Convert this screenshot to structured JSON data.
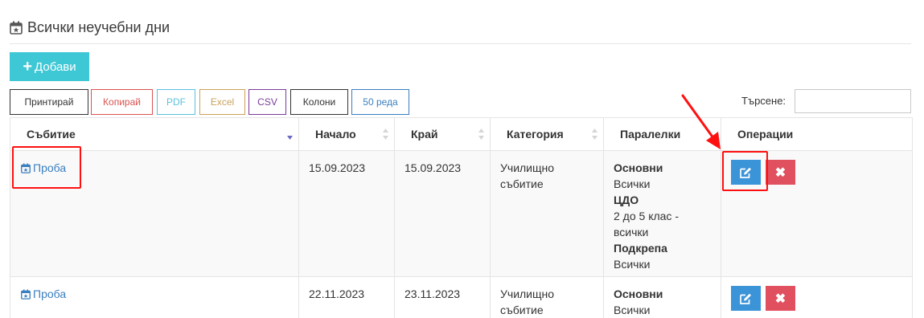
{
  "page": {
    "title": "Всички неучебни дни",
    "add_label": "Добави"
  },
  "export_buttons": [
    {
      "label": "Принтирай",
      "color": "#333333"
    },
    {
      "label": "Копирай",
      "color": "#d9534f"
    },
    {
      "label": "PDF",
      "color": "#5bc0de"
    },
    {
      "label": "Excel",
      "color": "#c9a25a"
    },
    {
      "label": "CSV",
      "color": "#7a3a9a"
    },
    {
      "label": "Колони",
      "color": "#333333"
    },
    {
      "label": "50 реда",
      "color": "#3a7fbf"
    }
  ],
  "search": {
    "label": "Търсене:",
    "value": ""
  },
  "table": {
    "headers": [
      "Събитие",
      "Начало",
      "Край",
      "Категория",
      "Паралелки",
      "Операции"
    ],
    "rows": [
      {
        "event": "Проба",
        "start": "15.09.2023",
        "end": "15.09.2023",
        "category_line1": "Училищно",
        "category_line2": "събитие",
        "classes": [
          {
            "group": "Основни",
            "lines": [
              "Всички"
            ]
          },
          {
            "group": "ЦДО",
            "lines": [
              "2 до 5 клас -",
              "всички"
            ]
          },
          {
            "group": "Подкрепа",
            "lines": [
              "Всички"
            ]
          }
        ]
      },
      {
        "event": "Проба",
        "start": "22.11.2023",
        "end": "23.11.2023",
        "category_line1": "Училищно",
        "category_line2": "събитие",
        "classes": [
          {
            "group": "Основни",
            "lines": [
              "Всички"
            ]
          }
        ]
      }
    ]
  },
  "icons": {
    "title": "calendar-star-icon",
    "add": "plus-icon",
    "event": "calendar-star-icon",
    "edit": "edit-icon",
    "delete": "close-icon",
    "sort": "sort-arrows-icon",
    "annotation": "red-arrow-icon"
  },
  "colors": {
    "add_button": "#3ec7d5",
    "edit_button": "#3b93d8",
    "delete_button": "#e0505f",
    "link": "#3a7fbf",
    "highlight": "#ff1010"
  }
}
